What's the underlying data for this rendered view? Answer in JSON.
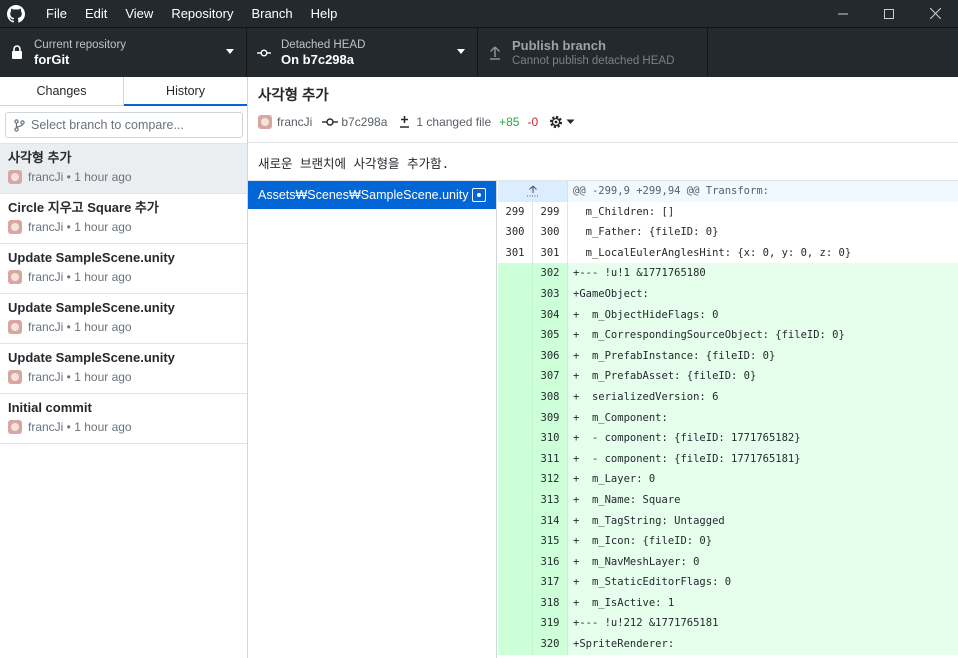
{
  "menu": [
    "File",
    "Edit",
    "View",
    "Repository",
    "Branch",
    "Help"
  ],
  "toolbar": {
    "repo_label": "Current repository",
    "repo_value": "forGit",
    "branch_label": "Detached HEAD",
    "branch_value": "On b7c298a",
    "publish_label": "Publish branch",
    "publish_sub": "Cannot publish detached HEAD"
  },
  "sidebar": {
    "tabs": [
      "Changes",
      "History"
    ],
    "compare_placeholder": "Select branch to compare...",
    "commits": [
      {
        "title": "사각형 추가",
        "meta": "francJi • 1 hour ago"
      },
      {
        "title": "Circle 지우고 Square 추가",
        "meta": "francJi • 1 hour ago"
      },
      {
        "title": "Update SampleScene.unity",
        "meta": "francJi • 1 hour ago"
      },
      {
        "title": "Update SampleScene.unity",
        "meta": "francJi • 1 hour ago"
      },
      {
        "title": "Update SampleScene.unity",
        "meta": "francJi • 1 hour ago"
      },
      {
        "title": "Initial commit",
        "meta": "francJi • 1 hour ago"
      }
    ]
  },
  "commit": {
    "title": "사각형 추가",
    "author": "francJi",
    "sha": "b7c298a",
    "changed_files": "1 changed file",
    "additions": "+85",
    "deletions": "-0",
    "body": "새로운 브랜치에 사각형을 추가함."
  },
  "files": [
    {
      "path": "Assets₩Scenes₩SampleScene.unity"
    }
  ],
  "diff": [
    {
      "type": "hunk",
      "old": "",
      "new": "",
      "text": "@@ -299,9 +299,94 @@ Transform:"
    },
    {
      "type": "ctx",
      "old": "299",
      "new": "299",
      "text": "  m_Children: []"
    },
    {
      "type": "ctx",
      "old": "300",
      "new": "300",
      "text": "  m_Father: {fileID: 0}"
    },
    {
      "type": "ctx",
      "old": "301",
      "new": "301",
      "text": "  m_LocalEulerAnglesHint: {x: 0, y: 0, z: 0}"
    },
    {
      "type": "add",
      "old": "",
      "new": "302",
      "text": "+--- !u!1 &1771765180"
    },
    {
      "type": "add",
      "old": "",
      "new": "303",
      "text": "+GameObject:"
    },
    {
      "type": "add",
      "old": "",
      "new": "304",
      "text": "+  m_ObjectHideFlags: 0"
    },
    {
      "type": "add",
      "old": "",
      "new": "305",
      "text": "+  m_CorrespondingSourceObject: {fileID: 0}"
    },
    {
      "type": "add",
      "old": "",
      "new": "306",
      "text": "+  m_PrefabInstance: {fileID: 0}"
    },
    {
      "type": "add",
      "old": "",
      "new": "307",
      "text": "+  m_PrefabAsset: {fileID: 0}"
    },
    {
      "type": "add",
      "old": "",
      "new": "308",
      "text": "+  serializedVersion: 6"
    },
    {
      "type": "add",
      "old": "",
      "new": "309",
      "text": "+  m_Component:"
    },
    {
      "type": "add",
      "old": "",
      "new": "310",
      "text": "+  - component: {fileID: 1771765182}"
    },
    {
      "type": "add",
      "old": "",
      "new": "311",
      "text": "+  - component: {fileID: 1771765181}"
    },
    {
      "type": "add",
      "old": "",
      "new": "312",
      "text": "+  m_Layer: 0"
    },
    {
      "type": "add",
      "old": "",
      "new": "313",
      "text": "+  m_Name: Square"
    },
    {
      "type": "add",
      "old": "",
      "new": "314",
      "text": "+  m_TagString: Untagged"
    },
    {
      "type": "add",
      "old": "",
      "new": "315",
      "text": "+  m_Icon: {fileID: 0}"
    },
    {
      "type": "add",
      "old": "",
      "new": "316",
      "text": "+  m_NavMeshLayer: 0"
    },
    {
      "type": "add",
      "old": "",
      "new": "317",
      "text": "+  m_StaticEditorFlags: 0"
    },
    {
      "type": "add",
      "old": "",
      "new": "318",
      "text": "+  m_IsActive: 1"
    },
    {
      "type": "add",
      "old": "",
      "new": "319",
      "text": "+--- !u!212 &1771765181"
    },
    {
      "type": "add",
      "old": "",
      "new": "320",
      "text": "+SpriteRenderer:"
    }
  ]
}
